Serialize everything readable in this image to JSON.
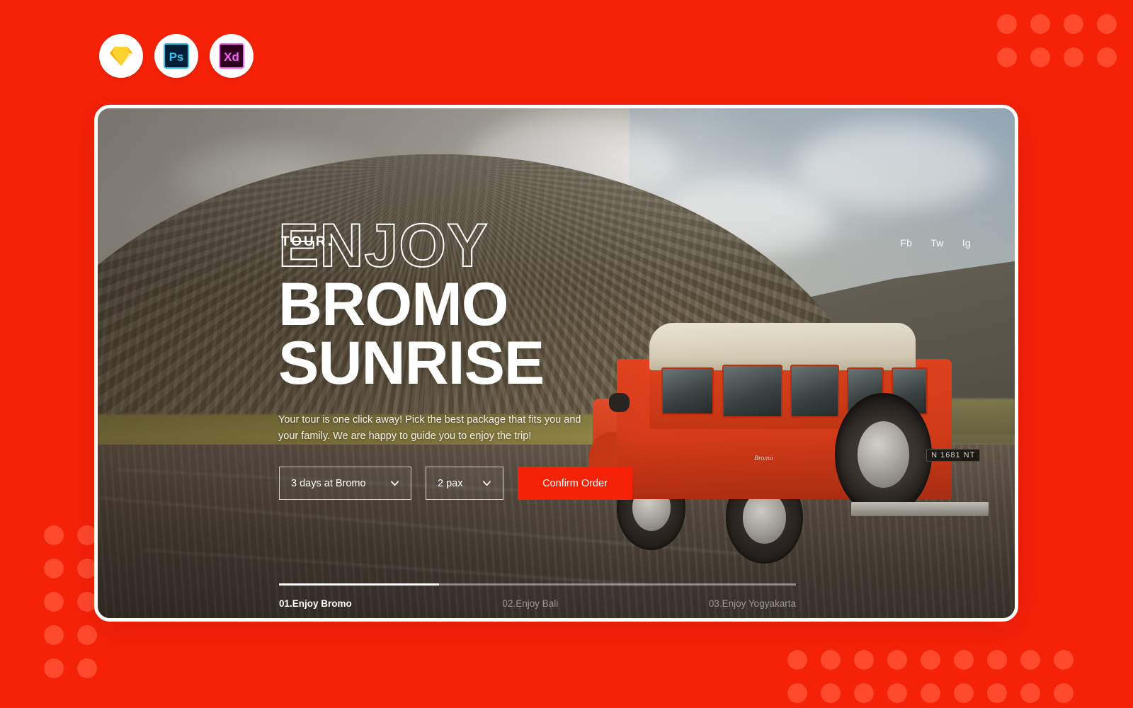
{
  "theme": {
    "brand_red": "#F52208",
    "dot_red": "#FF4A2E",
    "white": "#FFFFFF"
  },
  "badges": [
    {
      "name": "sketch",
      "label": "Sketch"
    },
    {
      "name": "photoshop",
      "label": "Ps"
    },
    {
      "name": "xd",
      "label": "Xd"
    }
  ],
  "hero": {
    "logo": "TOUR",
    "logo_dot": ".",
    "nav": [
      {
        "label": "Fb"
      },
      {
        "label": "Tw"
      },
      {
        "label": "Ig"
      }
    ],
    "headline_outline": "ENJOY",
    "headline_line2": "BROMO",
    "headline_line3": "SUNRISE",
    "subtitle": "Your tour is one click away! Pick the best package that fits you and your family. We are happy to guide you to enjoy the trip!",
    "form": {
      "package_value": "3 days at Bromo",
      "pax_value": "2 pax",
      "submit_label": "Confirm Order"
    },
    "pagination": {
      "progress_percent": 31,
      "items": [
        {
          "label": "01.Enjoy Bromo",
          "active": true
        },
        {
          "label": "02.Enjoy Bali",
          "active": false
        },
        {
          "label": "03.Enjoy Yogyakarta",
          "active": false
        }
      ]
    },
    "photo": {
      "license_plate": "N 1681 NT",
      "vehicle_decal": "Bromo"
    }
  }
}
